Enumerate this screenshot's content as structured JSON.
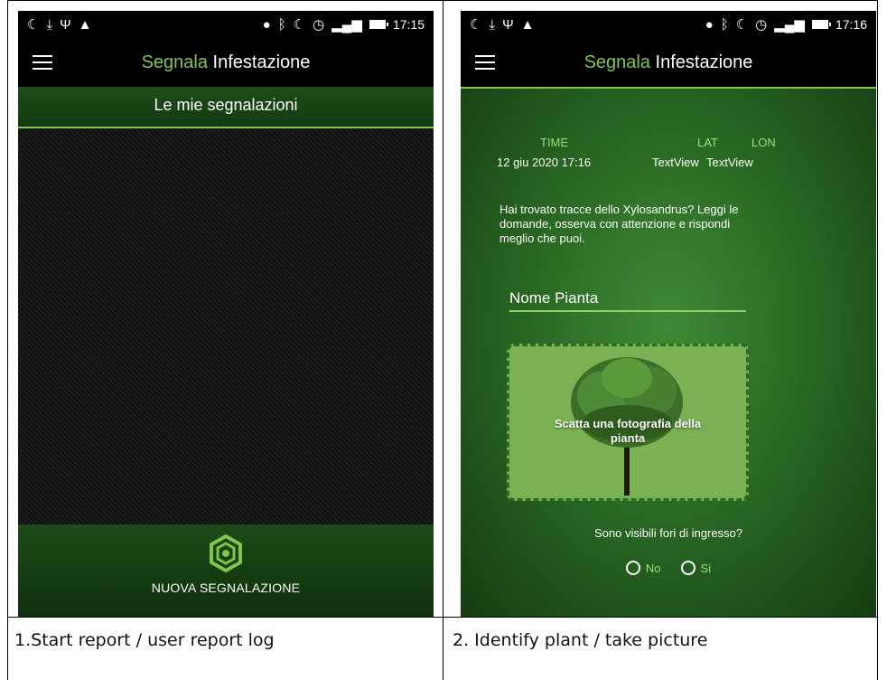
{
  "captions": {
    "left": "1.Start report / user report log",
    "right": "2. Identify plant / take picture"
  },
  "phone1": {
    "time": "17:15",
    "title_green": "Segnala",
    "title_white": " Infestazione",
    "header": "Le mie segnalazioni",
    "new_report_label": "NUOVA SEGNALAZIONE"
  },
  "phone2": {
    "time": "17:16",
    "title_green": "Segnala",
    "title_white": " Infestazione",
    "time_label": "TIME",
    "lat_label": "LAT",
    "lon_label": "LON",
    "date_value": "12 giu 2020 17:16",
    "lat_value": "TextView",
    "lon_value": "TextView",
    "intro": "Hai trovato tracce dello Xylosandrus? Leggi le domande, osserva con attenzione e rispondi meglio che puoi.",
    "plant_name_placeholder": "Nome Pianta",
    "photo_prompt": "Scatta una fotografia della pianta",
    "question": "Sono visibili fori di ingresso?",
    "option_no": "No",
    "option_yes": "Si"
  },
  "colors": {
    "accent_green": "#7fc64b",
    "dark_green": "#153d12"
  },
  "icons": [
    "moon-icon",
    "download-icon",
    "usb-icon",
    "warning-icon",
    "location-icon",
    "bluetooth-icon",
    "alarm-icon",
    "signal-icon",
    "battery-icon",
    "menu-icon",
    "camera-hexagon-icon",
    "tree-icon"
  ]
}
